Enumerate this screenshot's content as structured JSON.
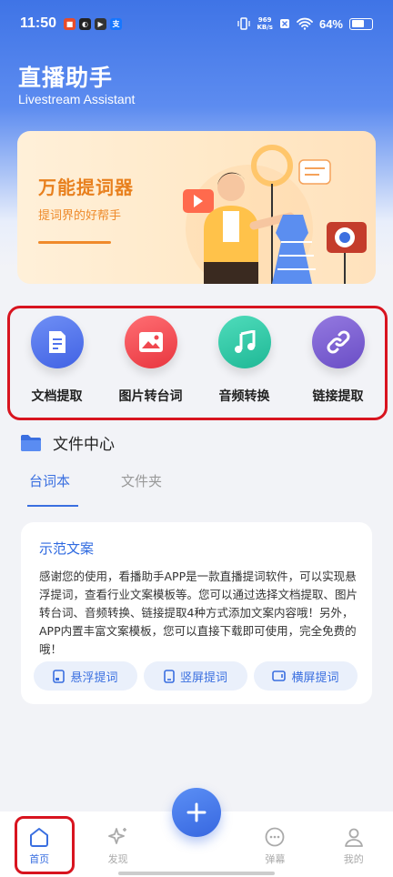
{
  "status_bar": {
    "time": "11:50",
    "net_speed_value": "969",
    "net_speed_unit": "KB/s",
    "battery_pct": "64%",
    "battery_level": 0.64
  },
  "header": {
    "title": "直播助手",
    "subtitle": "Livestream Assistant"
  },
  "banner": {
    "title": "万能提词器",
    "subtitle": "提词界的好帮手"
  },
  "features": [
    {
      "label": "文档提取",
      "icon": "document-icon",
      "color": "#4f72ec"
    },
    {
      "label": "图片转台词",
      "icon": "image-icon",
      "color": "#f0484f"
    },
    {
      "label": "音频转换",
      "icon": "music-icon",
      "color": "#2cc7a6"
    },
    {
      "label": "链接提取",
      "icon": "link-icon",
      "color": "#7b5fd0"
    }
  ],
  "file_center": {
    "title": "文件中心",
    "tabs": [
      {
        "label": "台词本",
        "active": true
      },
      {
        "label": "文件夹",
        "active": false
      }
    ]
  },
  "card": {
    "title": "示范文案",
    "body": "感谢您的使用，看播助手APP是一款直播提词软件，可以实现悬浮提词，查看行业文案模板等。您可以通过选择文档提取、图片转台词、音频转换、链接提取4种方式添加文案内容哦！另外，APP内置丰富文案模板，您可以直接下载即可使用，完全免费的哦！",
    "buttons": [
      {
        "label": "悬浮提词",
        "icon": "float-window-icon"
      },
      {
        "label": "竖屏提词",
        "icon": "portrait-icon"
      },
      {
        "label": "横屏提词",
        "icon": "landscape-icon"
      }
    ]
  },
  "bottom_nav": {
    "items": [
      {
        "label": "首页",
        "icon": "home-icon",
        "active": true
      },
      {
        "label": "发现",
        "icon": "sparkle-icon",
        "active": false
      },
      {
        "label": "弹幕",
        "icon": "chat-bubble-icon",
        "active": false
      },
      {
        "label": "我的",
        "icon": "user-icon",
        "active": false
      }
    ],
    "fab_icon": "plus-icon"
  },
  "colors": {
    "accent": "#3a6fe0",
    "highlight_box": "#d8141f",
    "banner_orange": "#e8801e"
  }
}
